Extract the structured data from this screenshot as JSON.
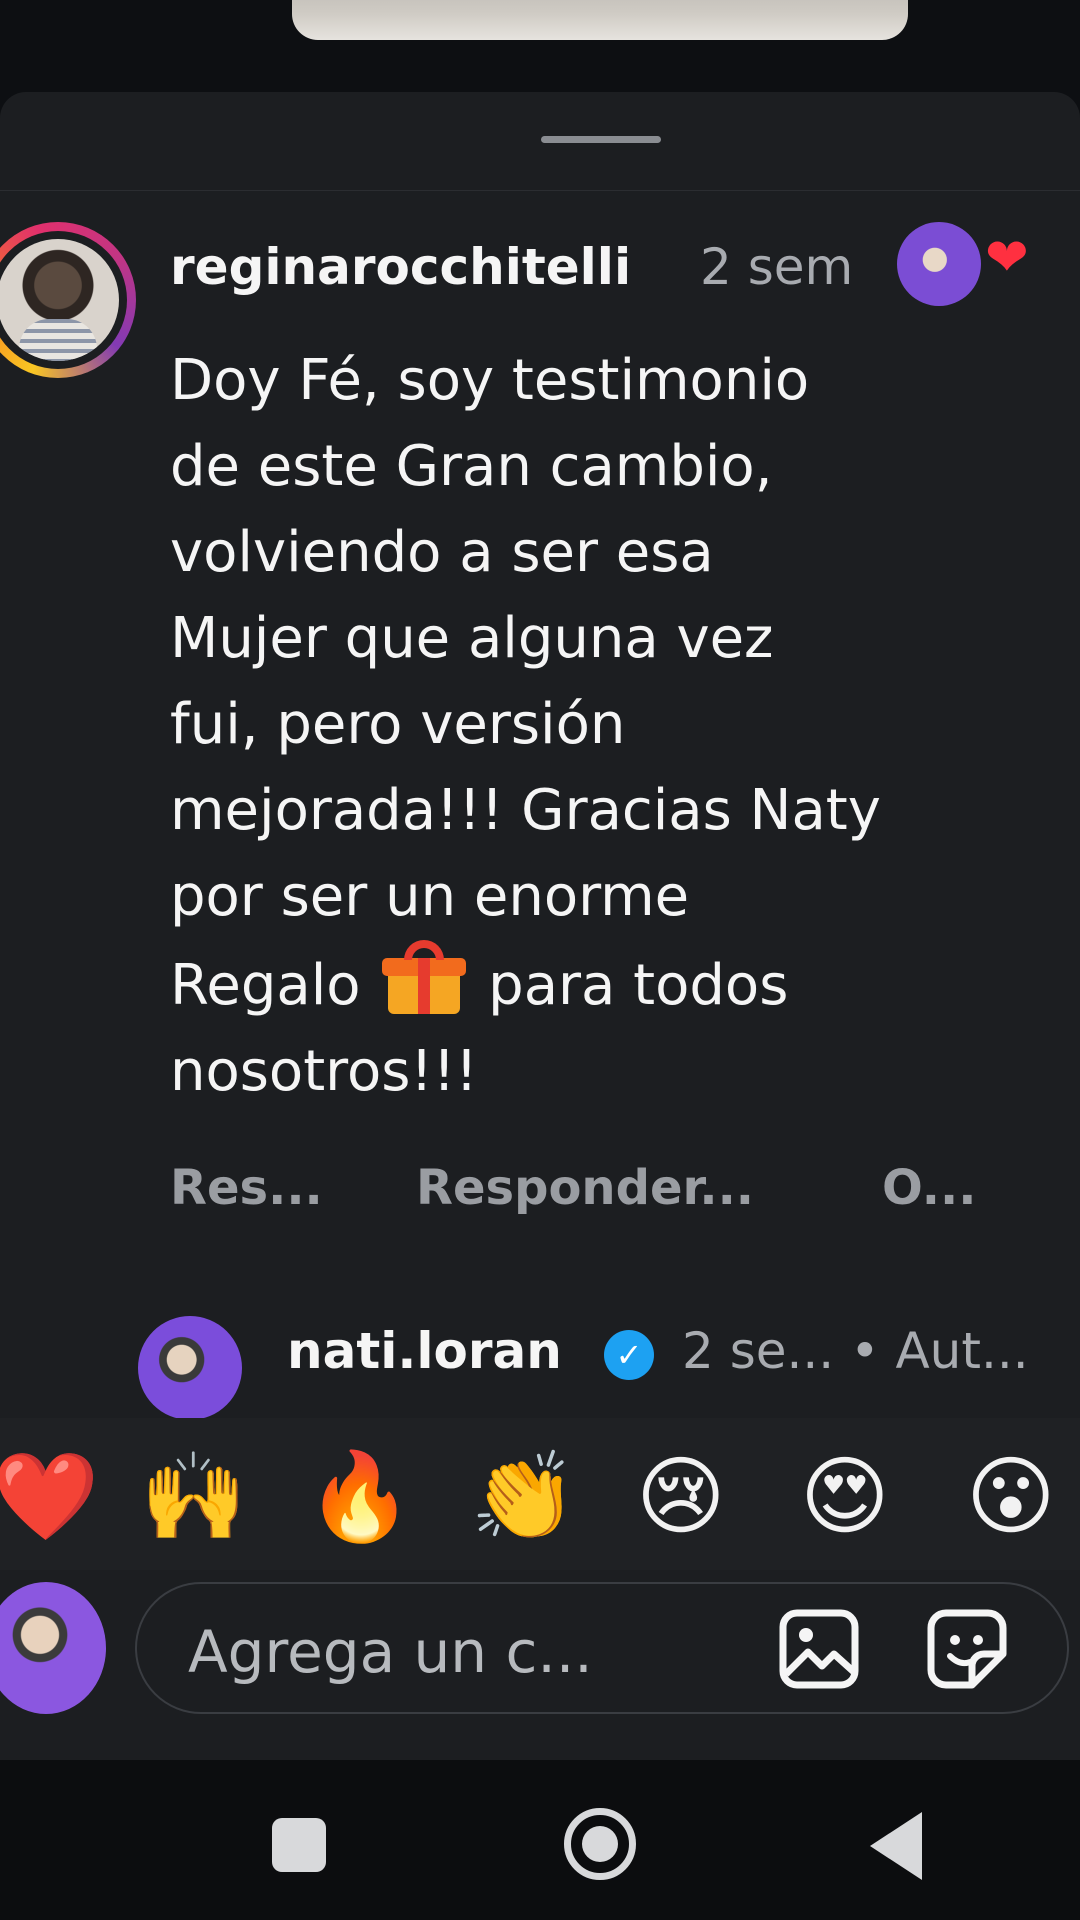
{
  "comment": {
    "username": "reginarocchitelli",
    "time": "2 sem",
    "lines": [
      "Doy Fé, soy testimonio",
      "de este Gran cambio,",
      "volviendo a ser esa",
      "Mujer que alguna vez",
      "fui, pero versión",
      "mejorada!!! Gracias Naty",
      "por ser un enorme"
    ],
    "line8_before": "Regalo",
    "line8_after": "para todos",
    "line9": "nosotros!!!",
    "actions": {
      "reply": "Res...",
      "reply2": "Responder...",
      "other": "O..."
    }
  },
  "reply": {
    "username": "nati.loran",
    "meta": "2 se... • Aut..."
  },
  "emoji_reactions": [
    "❤️",
    "🙌",
    "🔥",
    "👏",
    "😢",
    "😍",
    "😮"
  ],
  "composer": {
    "placeholder": "Agrega un c..."
  },
  "icons": {
    "like": "heart-icon",
    "verified": "verified-badge-icon",
    "gallery": "image-icon",
    "sticker": "sticker-icon",
    "nav": [
      "recents-icon",
      "home-icon",
      "back-icon"
    ]
  },
  "colors": {
    "background": "#1c1e21",
    "like_heart": "#ff3040",
    "verified": "#1da1f2"
  }
}
